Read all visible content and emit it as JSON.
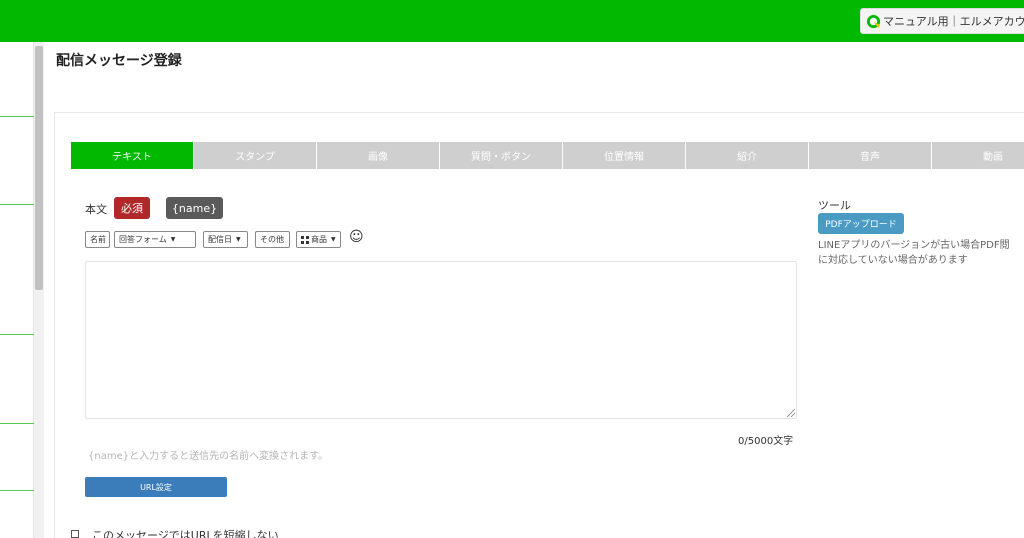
{
  "header": {
    "account_label": "マニュアル用｜エルメアカウント"
  },
  "page": {
    "title": "配信メッセージ登録"
  },
  "tabs": [
    {
      "label": "テキスト",
      "active": true
    },
    {
      "label": "スタンプ",
      "active": false
    },
    {
      "label": "画像",
      "active": false
    },
    {
      "label": "質問・ボタン",
      "active": false
    },
    {
      "label": "位置情報",
      "active": false
    },
    {
      "label": "紹介",
      "active": false
    },
    {
      "label": "音声",
      "active": false
    },
    {
      "label": "動画",
      "active": false
    }
  ],
  "editor": {
    "body_label": "本文",
    "required_badge": "必須",
    "name_button": "{name}",
    "insert_buttons": {
      "name": "名前",
      "answer_form": "回答フォーム",
      "delivery_date": "配信日",
      "other": "その他",
      "product": "商品"
    },
    "emoji_glyph": "☺",
    "message_value": "",
    "char_count": "0/5000文字",
    "hint": "{name}と入力すると送信先の名前へ変換されます。",
    "url_button": "URL設定",
    "shorten_checkbox_label": "このメッセージではURLを短縮しない",
    "shorten_checked": false
  },
  "tools": {
    "title": "ツール",
    "pdf_button": "PDFアップロード",
    "note_line1": "LINEアプリのバージョンが古い場合PDF閲",
    "note_line2": "に対応していない場合があります"
  },
  "colors": {
    "brand_green": "#00b900",
    "tab_inactive": "#cfcfcf",
    "required_red": "#b0282a",
    "url_blue": "#3a7dba",
    "pdf_blue": "#4a9ac4"
  }
}
